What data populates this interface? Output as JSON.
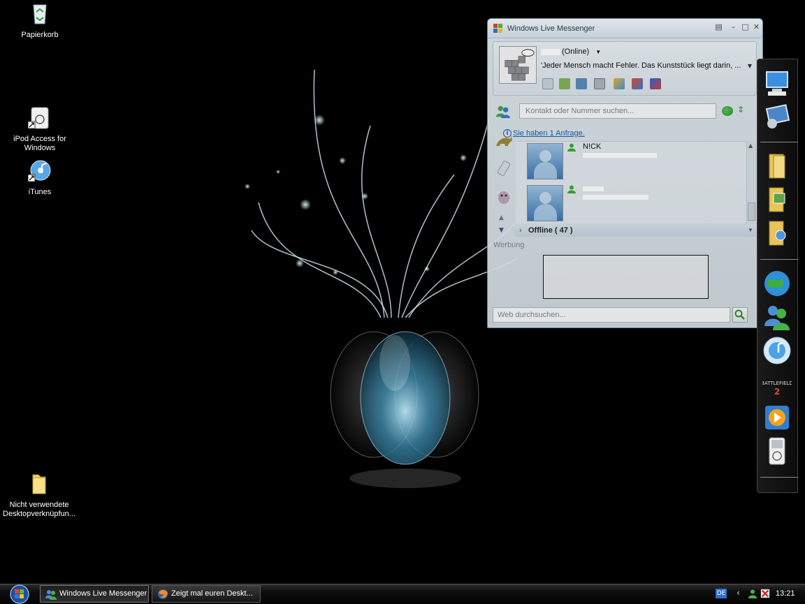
{
  "desktop": {
    "icons": [
      {
        "label": "Papierkorb"
      },
      {
        "label": "iPod Access for Windows"
      },
      {
        "label": "iTunes"
      },
      {
        "label": "Nicht verwendete Desktopverknüpfun..."
      }
    ]
  },
  "messenger": {
    "title": "Windows Live Messenger",
    "status": "(Online)",
    "personal_message": "'Jeder Mensch macht Fehler. Das Kunststück liegt darin, ...",
    "search_placeholder": "Kontakt oder Nummer suchen...",
    "request_link": "Sie haben 1 Anfrage.",
    "contacts": [
      {
        "name": "N!CK"
      },
      {
        "name": ""
      }
    ],
    "group_offline": "Offline ( 47 )",
    "ad_label": "Werbung",
    "web_search_placeholder": "Web durchsuchen..."
  },
  "taskbar": {
    "buttons": [
      {
        "label": "Windows Live Messenger",
        "active": true
      },
      {
        "label": "Zeigt mal euren Deskt...",
        "active": false
      }
    ],
    "language": "DE",
    "clock": "13:21"
  },
  "dock": {
    "icons": [
      "my-computer-icon",
      "control-panel-icon",
      "folder-icon",
      "pictures-folder-icon",
      "music-folder-icon",
      "internet-explorer-icon",
      "messenger-icon",
      "itunes-icon",
      "battlefield-2-icon",
      "media-player-icon",
      "ipod-icon"
    ]
  },
  "colors": {
    "accent": "#1a5fb4",
    "messenger_bg": "#dde6ec",
    "online_green": "#3aa93a"
  }
}
